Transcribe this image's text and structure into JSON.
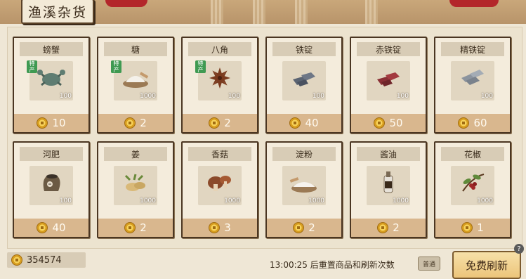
{
  "shop": {
    "title": "渔溪杂货"
  },
  "tag_label": "特产",
  "items": [
    {
      "name": "螃蟹",
      "qty": "100",
      "price": "10",
      "special": true,
      "icon": "crab-icon"
    },
    {
      "name": "糖",
      "qty": "1000",
      "price": "2",
      "special": true,
      "icon": "sugar-icon"
    },
    {
      "name": "八角",
      "qty": "100",
      "price": "2",
      "special": true,
      "icon": "star-anise-icon"
    },
    {
      "name": "铁锭",
      "qty": "100",
      "price": "40",
      "special": false,
      "icon": "iron-ingot-icon"
    },
    {
      "name": "赤铁锭",
      "qty": "100",
      "price": "50",
      "special": false,
      "icon": "red-iron-ingot-icon"
    },
    {
      "name": "精铁锭",
      "qty": "100",
      "price": "60",
      "special": false,
      "icon": "refined-iron-ingot-icon"
    },
    {
      "name": "河肥",
      "qty": "100",
      "price": "40",
      "special": false,
      "icon": "fertilizer-icon"
    },
    {
      "name": "姜",
      "qty": "1000",
      "price": "2",
      "special": false,
      "icon": "ginger-icon"
    },
    {
      "name": "香菇",
      "qty": "1000",
      "price": "3",
      "special": false,
      "icon": "mushroom-icon"
    },
    {
      "name": "淀粉",
      "qty": "1000",
      "price": "2",
      "special": false,
      "icon": "starch-icon"
    },
    {
      "name": "酱油",
      "qty": "1000",
      "price": "2",
      "special": false,
      "icon": "soy-sauce-icon"
    },
    {
      "name": "花椒",
      "qty": "1000",
      "price": "1",
      "special": false,
      "icon": "pepper-icon"
    }
  ],
  "footer": {
    "coins": "354574",
    "refresh_text": "13:00:25 后重置商品和刷新次数",
    "refresh_badge": "普通",
    "free_refresh_label": "免费刷新"
  },
  "colors": {
    "price_bar": "#d9b78e",
    "card_border": "#4b3622",
    "special_tag": "#3f9a52"
  }
}
